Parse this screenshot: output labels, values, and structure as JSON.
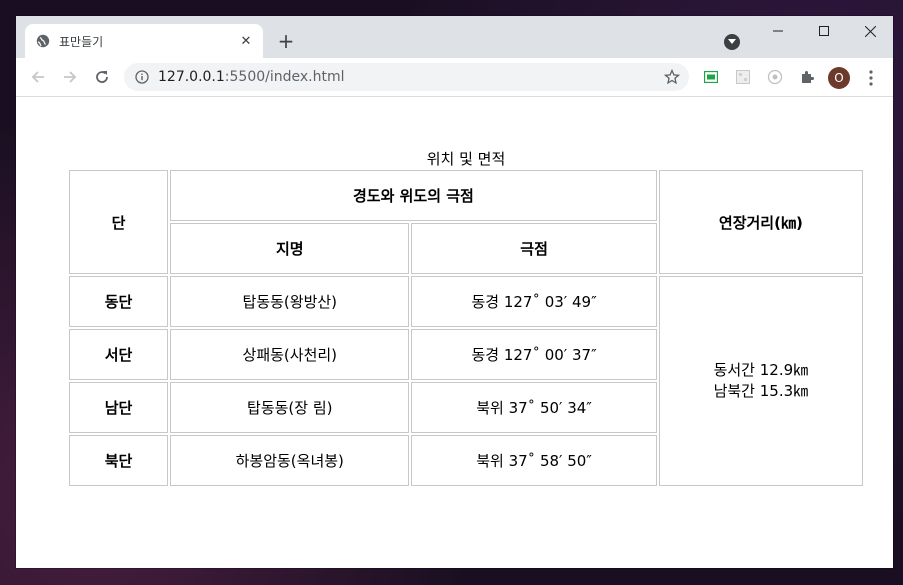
{
  "browser": {
    "tab_title": "표만들기",
    "url_host": "127.0.0.1",
    "url_rest": ":5500/index.html",
    "new_tab_symbol": "+",
    "profile_initial": "O"
  },
  "page": {
    "caption": "위치 및 면적",
    "headers": {
      "dan": "단",
      "group": "경도와 위도의 극점",
      "jimyeong": "지명",
      "geukjeom": "극점",
      "distance": "연장거리(㎞)"
    },
    "rows": [
      {
        "dan": "동단",
        "place": "탑동동(왕방산)",
        "point": "동경 127˚ 03′ 49″"
      },
      {
        "dan": "서단",
        "place": "상패동(사천리)",
        "point": "동경 127˚ 00′ 37″"
      },
      {
        "dan": "남단",
        "place": "탑동동(장 림)",
        "point": "북위 37˚ 50′ 34″"
      },
      {
        "dan": "북단",
        "place": "하봉암동(옥녀봉)",
        "point": "북위 37˚ 58′ 50″"
      }
    ],
    "distance_lines": [
      "동서간 12.9㎞",
      "남북간 15.3㎞"
    ]
  }
}
